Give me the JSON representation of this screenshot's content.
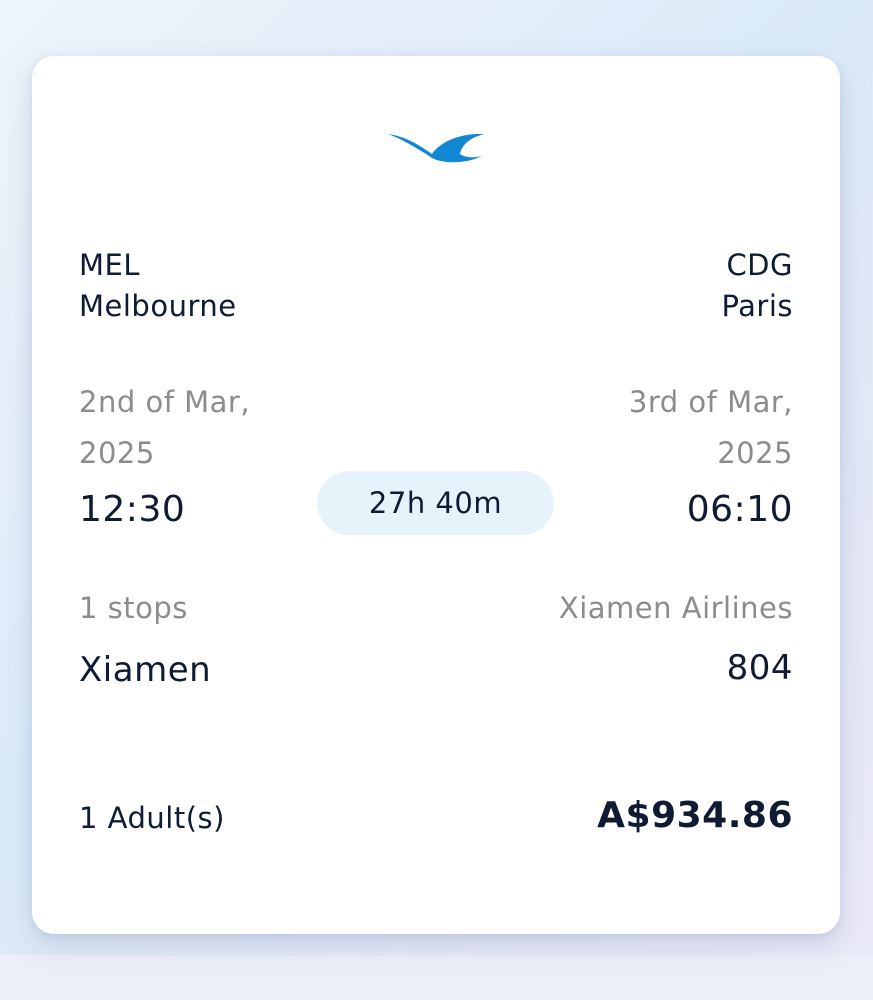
{
  "flight": {
    "origin": {
      "code": "MEL",
      "city": "Melbourne",
      "date_line1": "2nd of Mar,",
      "date_line2": "2025",
      "time": "12:30"
    },
    "destination": {
      "code": "CDG",
      "city": "Paris",
      "date_line1": "3rd of Mar,",
      "date_line2": "2025",
      "time": "06:10"
    },
    "duration": "27h 40m",
    "stops_label": "1 stops",
    "stop_city": "Xiamen",
    "airline": "Xiamen Airlines",
    "flight_number": "804",
    "passengers": "1 Adult(s)",
    "price": "A$934.86"
  },
  "icons": {
    "airline_logo": "xiamen-airlines-egret-logo"
  },
  "colors": {
    "logo": "#1288d2",
    "duration_pill": "#e6f3fb",
    "text": "#0f1b33",
    "muted": "#8c8c8c"
  }
}
